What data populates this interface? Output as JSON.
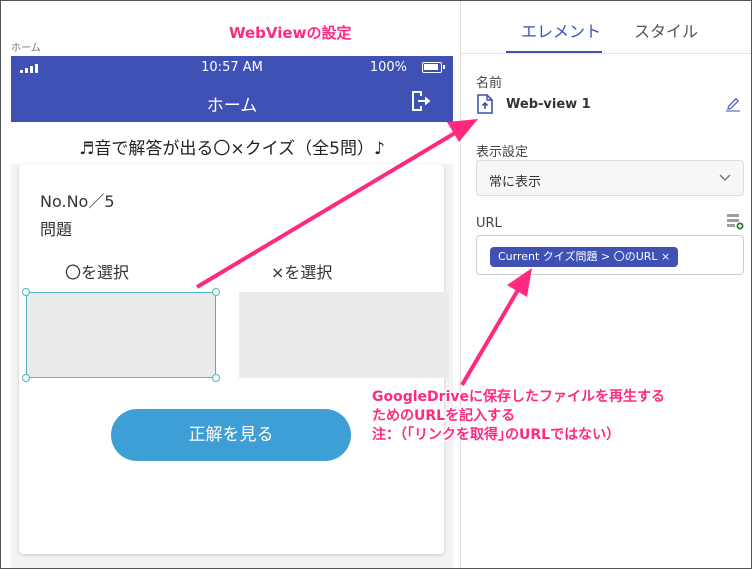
{
  "preview": {
    "screen_label": "ホーム",
    "status_bar": {
      "time": "10:57 AM",
      "battery": "100%"
    },
    "header": {
      "title": "ホーム",
      "icon": "logout-icon"
    },
    "quiz_title": "♬音で解答が出る〇×クイズ（全5問）♪",
    "card": {
      "question_number": "No.No／5",
      "question_label": "問題",
      "option_o_label": "〇を選択",
      "option_x_label": "×を選択",
      "answer_button": "正解を見る"
    }
  },
  "panel": {
    "tabs": [
      {
        "label": "エレメント",
        "active": true
      },
      {
        "label": "スタイル",
        "active": false
      }
    ],
    "name_label": "名前",
    "name_value": "Web-view 1",
    "display_label": "表示設定",
    "display_value": "常に表示",
    "url_label": "URL",
    "url_chip": "Current クイズ問題 > 〇のURL ×"
  },
  "annotations": {
    "title": "WebViewの設定",
    "note_lines": [
      "GoogleDriveに保存したファイルを再生する",
      "ためのURLを記入する",
      "注：（｢リンクを取得｣のURLではない）"
    ]
  },
  "colors": {
    "app_bar": "#3f51b5",
    "button": "#3e9fd6",
    "annotation": "#ff2a7f",
    "selection": "#4db6c4"
  }
}
